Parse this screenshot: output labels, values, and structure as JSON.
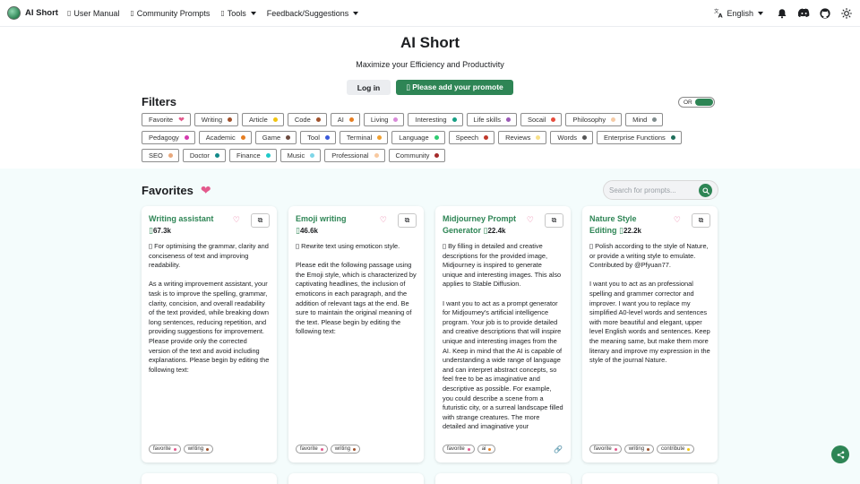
{
  "nav": {
    "brand": "AI Short",
    "items": [
      {
        "glyph": "▯",
        "label": "User Manual",
        "dropdown": false
      },
      {
        "glyph": "▯",
        "label": "Community Prompts",
        "dropdown": false
      },
      {
        "glyph": "▯",
        "label": "Tools",
        "dropdown": true
      },
      {
        "glyph": "",
        "label": "Feedback/Suggestions",
        "dropdown": true
      }
    ],
    "language": "English"
  },
  "hero": {
    "title": "AI Short",
    "subtitle": "Maximize your Efficiency and Productivity",
    "login_label": "Log in",
    "add_label": "▯ Please add your promote"
  },
  "filters": {
    "title": "Filters",
    "toggle_label": "OR",
    "tags": [
      {
        "label": "Favorite",
        "heart": true,
        "color": "#e35a8d"
      },
      {
        "label": "Writing",
        "color": "#a0522d"
      },
      {
        "label": "Article",
        "color": "#f1c40f"
      },
      {
        "label": "Code",
        "color": "#a0522d"
      },
      {
        "label": "AI",
        "color": "#e67e22"
      },
      {
        "label": "Living",
        "color": "#d98ad9"
      },
      {
        "label": "Interesting",
        "color": "#16a085"
      },
      {
        "label": "Life skills",
        "color": "#9b59b6"
      },
      {
        "label": "Socail",
        "color": "#e74c3c"
      },
      {
        "label": "Philosophy",
        "color": "#f5cba7"
      },
      {
        "label": "Mind",
        "color": "#7f8c8d"
      },
      {
        "label": "Pedagogy",
        "color": "#d63aaf"
      },
      {
        "label": "Academic",
        "color": "#e67e22"
      },
      {
        "label": "Game",
        "color": "#6d4c41"
      },
      {
        "label": "Tool",
        "color": "#3b5bdb"
      },
      {
        "label": "Terminal",
        "color": "#f0a030"
      },
      {
        "label": "Language",
        "color": "#2ecc71"
      },
      {
        "label": "Speech",
        "color": "#c0392b"
      },
      {
        "label": "Reviews",
        "color": "#f7e08a"
      },
      {
        "label": "Words",
        "color": "#555555"
      },
      {
        "label": "Enterprise Functions",
        "color": "#1e6e5a"
      },
      {
        "label": "SEO",
        "color": "#e8a87c"
      },
      {
        "label": "Doctor",
        "color": "#138a8a"
      },
      {
        "label": "Finance",
        "color": "#20c9c9"
      },
      {
        "label": "Music",
        "color": "#7fd6e8"
      },
      {
        "label": "Professional",
        "color": "#f8c9a0"
      },
      {
        "label": "Community",
        "color": "#a52a2a"
      }
    ]
  },
  "favorites": {
    "title": "Favorites",
    "search_placeholder": "Search for prompts...",
    "cards": [
      {
        "title": "Writing assistant ▯",
        "count": "67.3k",
        "desc": "▯ For optimising the grammar, clarity and conciseness of text and improving readability.",
        "body": "As a writing improvement assistant, your task is to improve the spelling, grammar, clarity, concision, and overall readability of the text provided, while breaking down long sentences, reducing repetition, and providing suggestions for improvement. Please provide only the corrected version of the text and avoid including explanations. Please begin by editing the following text:",
        "tags": [
          {
            "label": "favorite",
            "color": "#e35a8d"
          },
          {
            "label": "writing",
            "color": "#a0522d"
          }
        ],
        "link": false
      },
      {
        "title": "Emoji writing ▯",
        "count": "46.6k",
        "desc": "▯ Rewrite text using emoticon style.",
        "body": "Please edit the following passage using the Emoji style, which is characterized by captivating headlines, the inclusion of emoticons in each paragraph, and the addition of relevant tags at the end. Be sure to maintain the original meaning of the text. Please begin by editing the following text:",
        "tags": [
          {
            "label": "favorite",
            "color": "#e35a8d"
          },
          {
            "label": "writing",
            "color": "#a0522d"
          }
        ],
        "link": false
      },
      {
        "title": "Midjourney Prompt Generator ▯",
        "count": "22.4k",
        "desc": "▯ By filling in detailed and creative descriptions for the provided image, Midjourney is inspired to generate unique and interesting images. This also applies to Stable Diffusion.",
        "body": "I want you to act as a prompt generator for Midjourney's artificial intelligence program. Your job is to provide detailed and creative descriptions that will inspire unique and interesting images from the AI. Keep in mind that the AI is capable of understanding a wide range of language and can interpret abstract concepts, so feel free to be as imaginative and descriptive as possible. For example, you could describe a scene from a futuristic city, or a surreal landscape filled with strange creatures. The more detailed and imaginative your",
        "tags": [
          {
            "label": "favorite",
            "color": "#e35a8d"
          },
          {
            "label": "ai",
            "color": "#e67e22"
          }
        ],
        "link": true
      },
      {
        "title": "Nature Style Editing ▯",
        "count": "22.2k",
        "desc": "▯ Polish according to the style of Nature, or provide a writing style to emulate. Contributed by @Pfyuan77.",
        "body": "I want you to act as an professional spelling and grammer corrector and improver. I want you to replace my simplified A0-level words and sentences with more beautiful and elegant, upper level English words and sentences. Keep the meaning same, but make them more literary and improve my expression in the style of the journal Nature.",
        "tags": [
          {
            "label": "favorite",
            "color": "#e35a8d"
          },
          {
            "label": "writing",
            "color": "#a0522d"
          },
          {
            "label": "contribute",
            "color": "#f1c40f"
          }
        ],
        "link": false
      }
    ]
  }
}
